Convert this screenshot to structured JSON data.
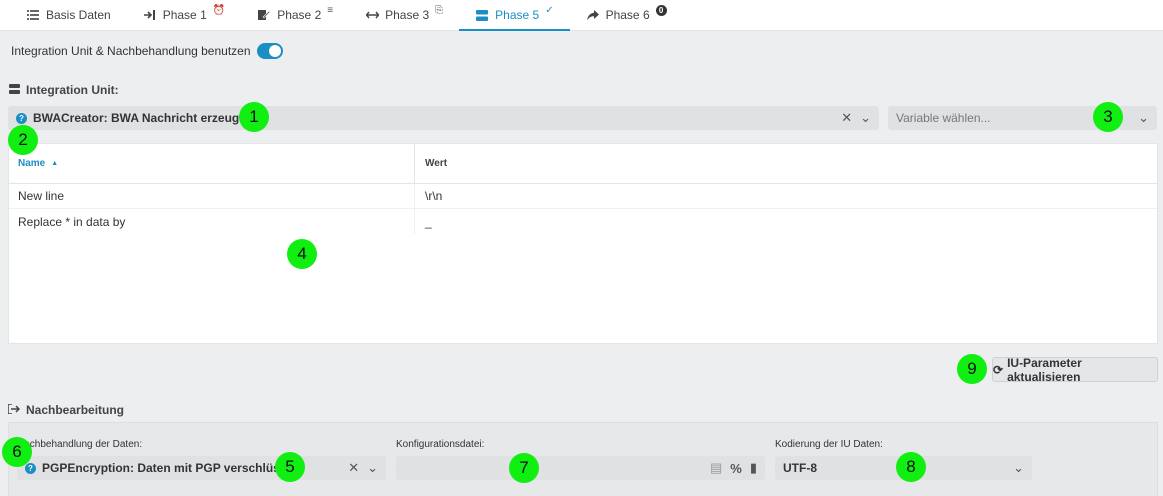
{
  "tabs": [
    {
      "label": "Basis Daten",
      "icon": "list-icon",
      "suffix": ""
    },
    {
      "label": "Phase 1",
      "icon": "sign-in-icon",
      "suffix": "⏰"
    },
    {
      "label": "Phase 2",
      "icon": "edit-icon",
      "suffix": "≡"
    },
    {
      "label": "Phase 3",
      "icon": "arrows-horizontal-icon",
      "suffix": "⎘"
    },
    {
      "label": "Phase 5",
      "icon": "server-icon",
      "suffix": "✓",
      "active": true
    },
    {
      "label": "Phase 6",
      "icon": "share-icon",
      "suffix": "0"
    }
  ],
  "toggle": {
    "label": "Integration Unit & Nachbehandlung benutzen",
    "on": true
  },
  "integration_unit": {
    "heading": "Integration Unit:",
    "selected": "BWACreator: BWA Nachricht erzeugen",
    "variable_placeholder": "Variable wählen..."
  },
  "table": {
    "headers": {
      "name": "Name",
      "value": "Wert"
    },
    "rows": [
      {
        "name": "New line",
        "value": "\\r\\n"
      },
      {
        "name": "Replace * in data by",
        "value": "_"
      }
    ]
  },
  "refresh_button": "IU-Parameter aktualisieren",
  "nachbearbeitung": {
    "heading": "Nachbearbeitung",
    "nachbehandlung_label": "Nachbehandlung der Daten:",
    "nachbehandlung_value": "PGPEncryption: Daten mit PGP verschlüsseln",
    "konfig_label": "Konfigurationsdatei:",
    "kodierung_label": "Kodierung der IU Daten:",
    "kodierung_value": "UTF-8"
  },
  "markers": [
    "1",
    "2",
    "3",
    "4",
    "5",
    "6",
    "7",
    "8",
    "9"
  ],
  "colors": {
    "accent": "#1a8fc4",
    "marker": "#11ee11"
  }
}
